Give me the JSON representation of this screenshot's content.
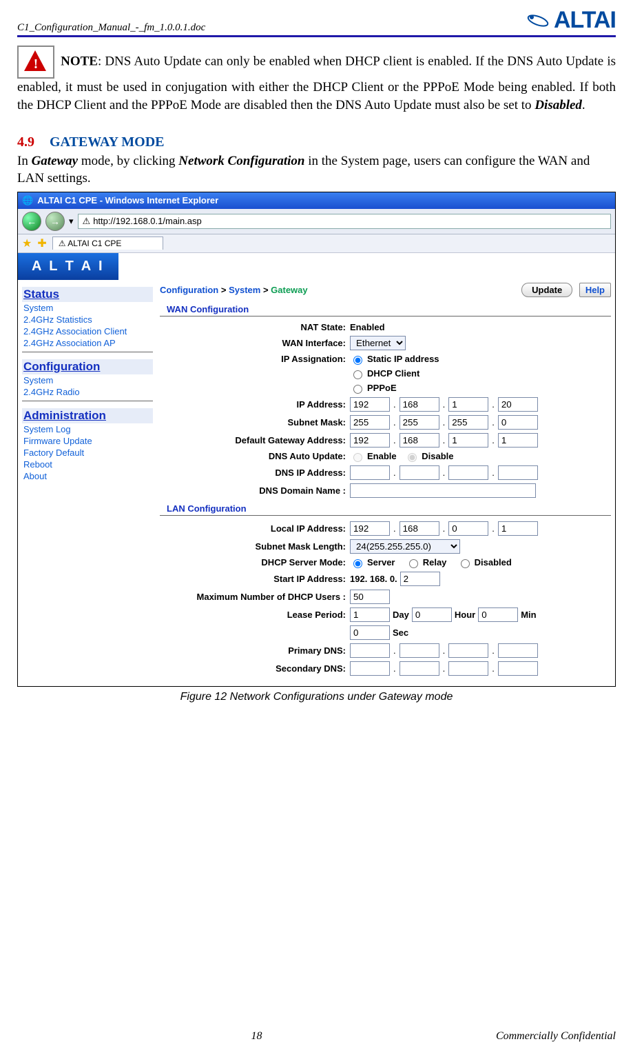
{
  "header": {
    "doc_name": "C1_Configuration_Manual_-_fm_1.0.0.1.doc",
    "brand": "ALTAI"
  },
  "note": {
    "label": "NOTE",
    "body_part1": ": DNS Auto Update can only be enabled when DHCP client is enabled. If the DNS Auto Update is enabled, it must be used in conjugation with either the DHCP Client or the PPPoE Mode being enabled. If both the DHCP Client and the PPPoE Mode are disabled then the DNS Auto Update must also be set to ",
    "emph": "Disabled",
    "body_part2": "."
  },
  "section": {
    "number": "4.9",
    "title": "GATEWAY MODE",
    "desc_pre": "In ",
    "desc_em1": "Gateway",
    "desc_mid": " mode, by clicking ",
    "desc_em2": "Network Configuration",
    "desc_post": " in the System page, users can configure the WAN and LAN settings."
  },
  "ie": {
    "title": "ALTAI C1 CPE - Windows Internet Explorer",
    "url": "http://192.168.0.1/main.asp",
    "tab": "ALTAI C1 CPE"
  },
  "sidebar": {
    "status_head": "Status",
    "status_items": [
      "System",
      "2.4GHz Statistics",
      "2.4GHz Association Client",
      "2.4GHz Association AP"
    ],
    "config_head": "Configuration",
    "config_items": [
      "System",
      "2.4GHz Radio"
    ],
    "admin_head": "Administration",
    "admin_items": [
      "System Log",
      "Firmware Update",
      "Factory Default",
      "Reboot",
      "About"
    ]
  },
  "breadcrumb": {
    "a": "Configuration",
    "b": "System",
    "c": "Gateway",
    "sep": ">"
  },
  "buttons": {
    "update": "Update",
    "help": "Help"
  },
  "wan": {
    "header": "WAN Configuration",
    "nat_label": "NAT State:",
    "nat_value": "Enabled",
    "iface_label": "WAN Interface:",
    "iface_value": "Ethernet",
    "assign_label": "IP Assignation:",
    "assign_static": "Static IP address",
    "assign_dhcp": "DHCP Client",
    "assign_pppoe": "PPPoE",
    "ip_label": "IP Address:",
    "ip": [
      "192",
      "168",
      "1",
      "20"
    ],
    "mask_label": "Subnet Mask:",
    "mask": [
      "255",
      "255",
      "255",
      "0"
    ],
    "gw_label": "Default Gateway Address:",
    "gw": [
      "192",
      "168",
      "1",
      "1"
    ],
    "dnsauto_label": "DNS Auto Update:",
    "dnsauto_enable": "Enable",
    "dnsauto_disable": "Disable",
    "dnsip_label": "DNS IP Address:",
    "dnsip": [
      "",
      "",
      "",
      ""
    ],
    "dnsdom_label": "DNS Domain Name :",
    "dnsdom": ""
  },
  "lan": {
    "header": "LAN Configuration",
    "localip_label": "Local IP Address:",
    "localip": [
      "192",
      "168",
      "0",
      "1"
    ],
    "masklen_label": "Subnet Mask Length:",
    "masklen_value": "24(255.255.255.0)",
    "dhcpmode_label": "DHCP Server Mode:",
    "mode_server": "Server",
    "mode_relay": "Relay",
    "mode_disabled": "Disabled",
    "startip_label": "Start IP Address:",
    "startip_prefix": "192. 168. 0.",
    "startip_last": "2",
    "maxusers_label": "Maximum Number of DHCP Users :",
    "maxusers": "50",
    "lease_label": "Lease Period:",
    "lease_day": "1",
    "lease_day_u": "Day",
    "lease_hour": "0",
    "lease_hour_u": "Hour",
    "lease_min": "0",
    "lease_min_u": "Min",
    "lease_sec": "0",
    "lease_sec_u": "Sec",
    "pdns_label": "Primary DNS:",
    "pdns": [
      "",
      "",
      "",
      ""
    ],
    "sdns_label": "Secondary DNS:",
    "sdns": [
      "",
      "",
      "",
      ""
    ]
  },
  "caption": "Figure 12    Network Configurations under Gateway mode",
  "footer": {
    "page": "18",
    "conf": "Commercially Confidential"
  }
}
